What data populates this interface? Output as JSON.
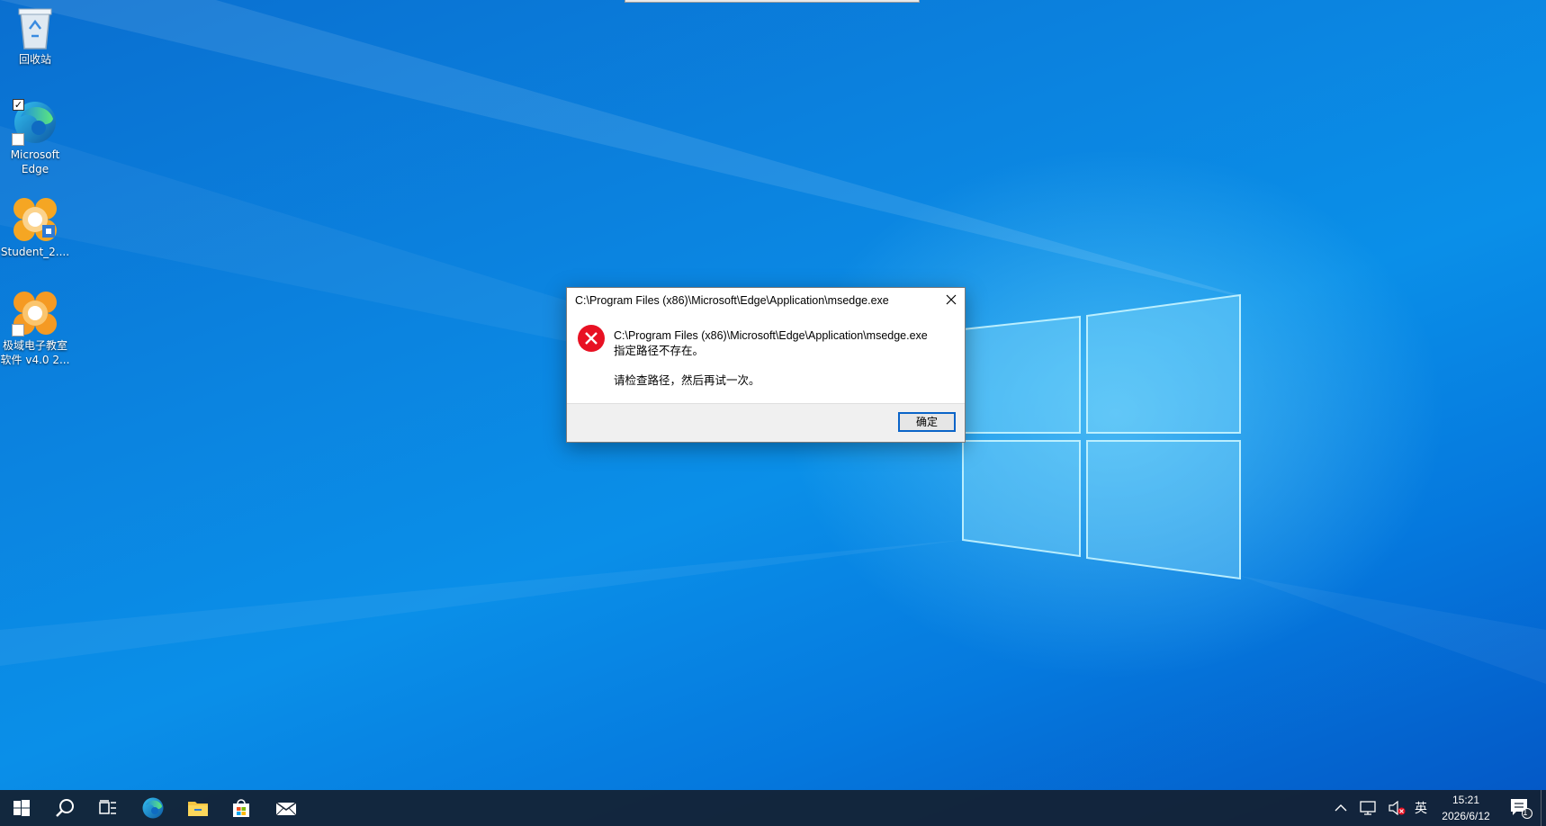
{
  "desktop": {
    "icons": [
      {
        "label": "回收站"
      },
      {
        "label_line1": "Microsoft",
        "label_line2": "Edge"
      },
      {
        "label": "Student_2...."
      },
      {
        "label_line1": "极域电子教室",
        "label_line2": "软件 v4.0 2..."
      }
    ]
  },
  "dialog": {
    "title": "C:\\Program Files (x86)\\Microsoft\\Edge\\Application\\msedge.exe",
    "message_path": "C:\\Program Files (x86)\\Microsoft\\Edge\\Application\\msedge.exe",
    "message_error": "指定路径不存在。",
    "message_hint": "请检查路径，然后再试一次。",
    "ok_label": "确定",
    "icon": "error-icon"
  },
  "taskbar": {
    "buttons": [
      "start-icon",
      "search-icon",
      "task-view-icon",
      "edge-icon",
      "file-explorer-icon",
      "store-icon",
      "mail-icon"
    ],
    "tray": {
      "ime": "英",
      "time": "15:21",
      "date": "2026/6/12",
      "notification_count": "1"
    }
  },
  "colors": {
    "desktop_blue": "#0a8fe8",
    "error_red": "#e81123",
    "button_border": "#0a64c8",
    "taskbar": "#142030"
  }
}
